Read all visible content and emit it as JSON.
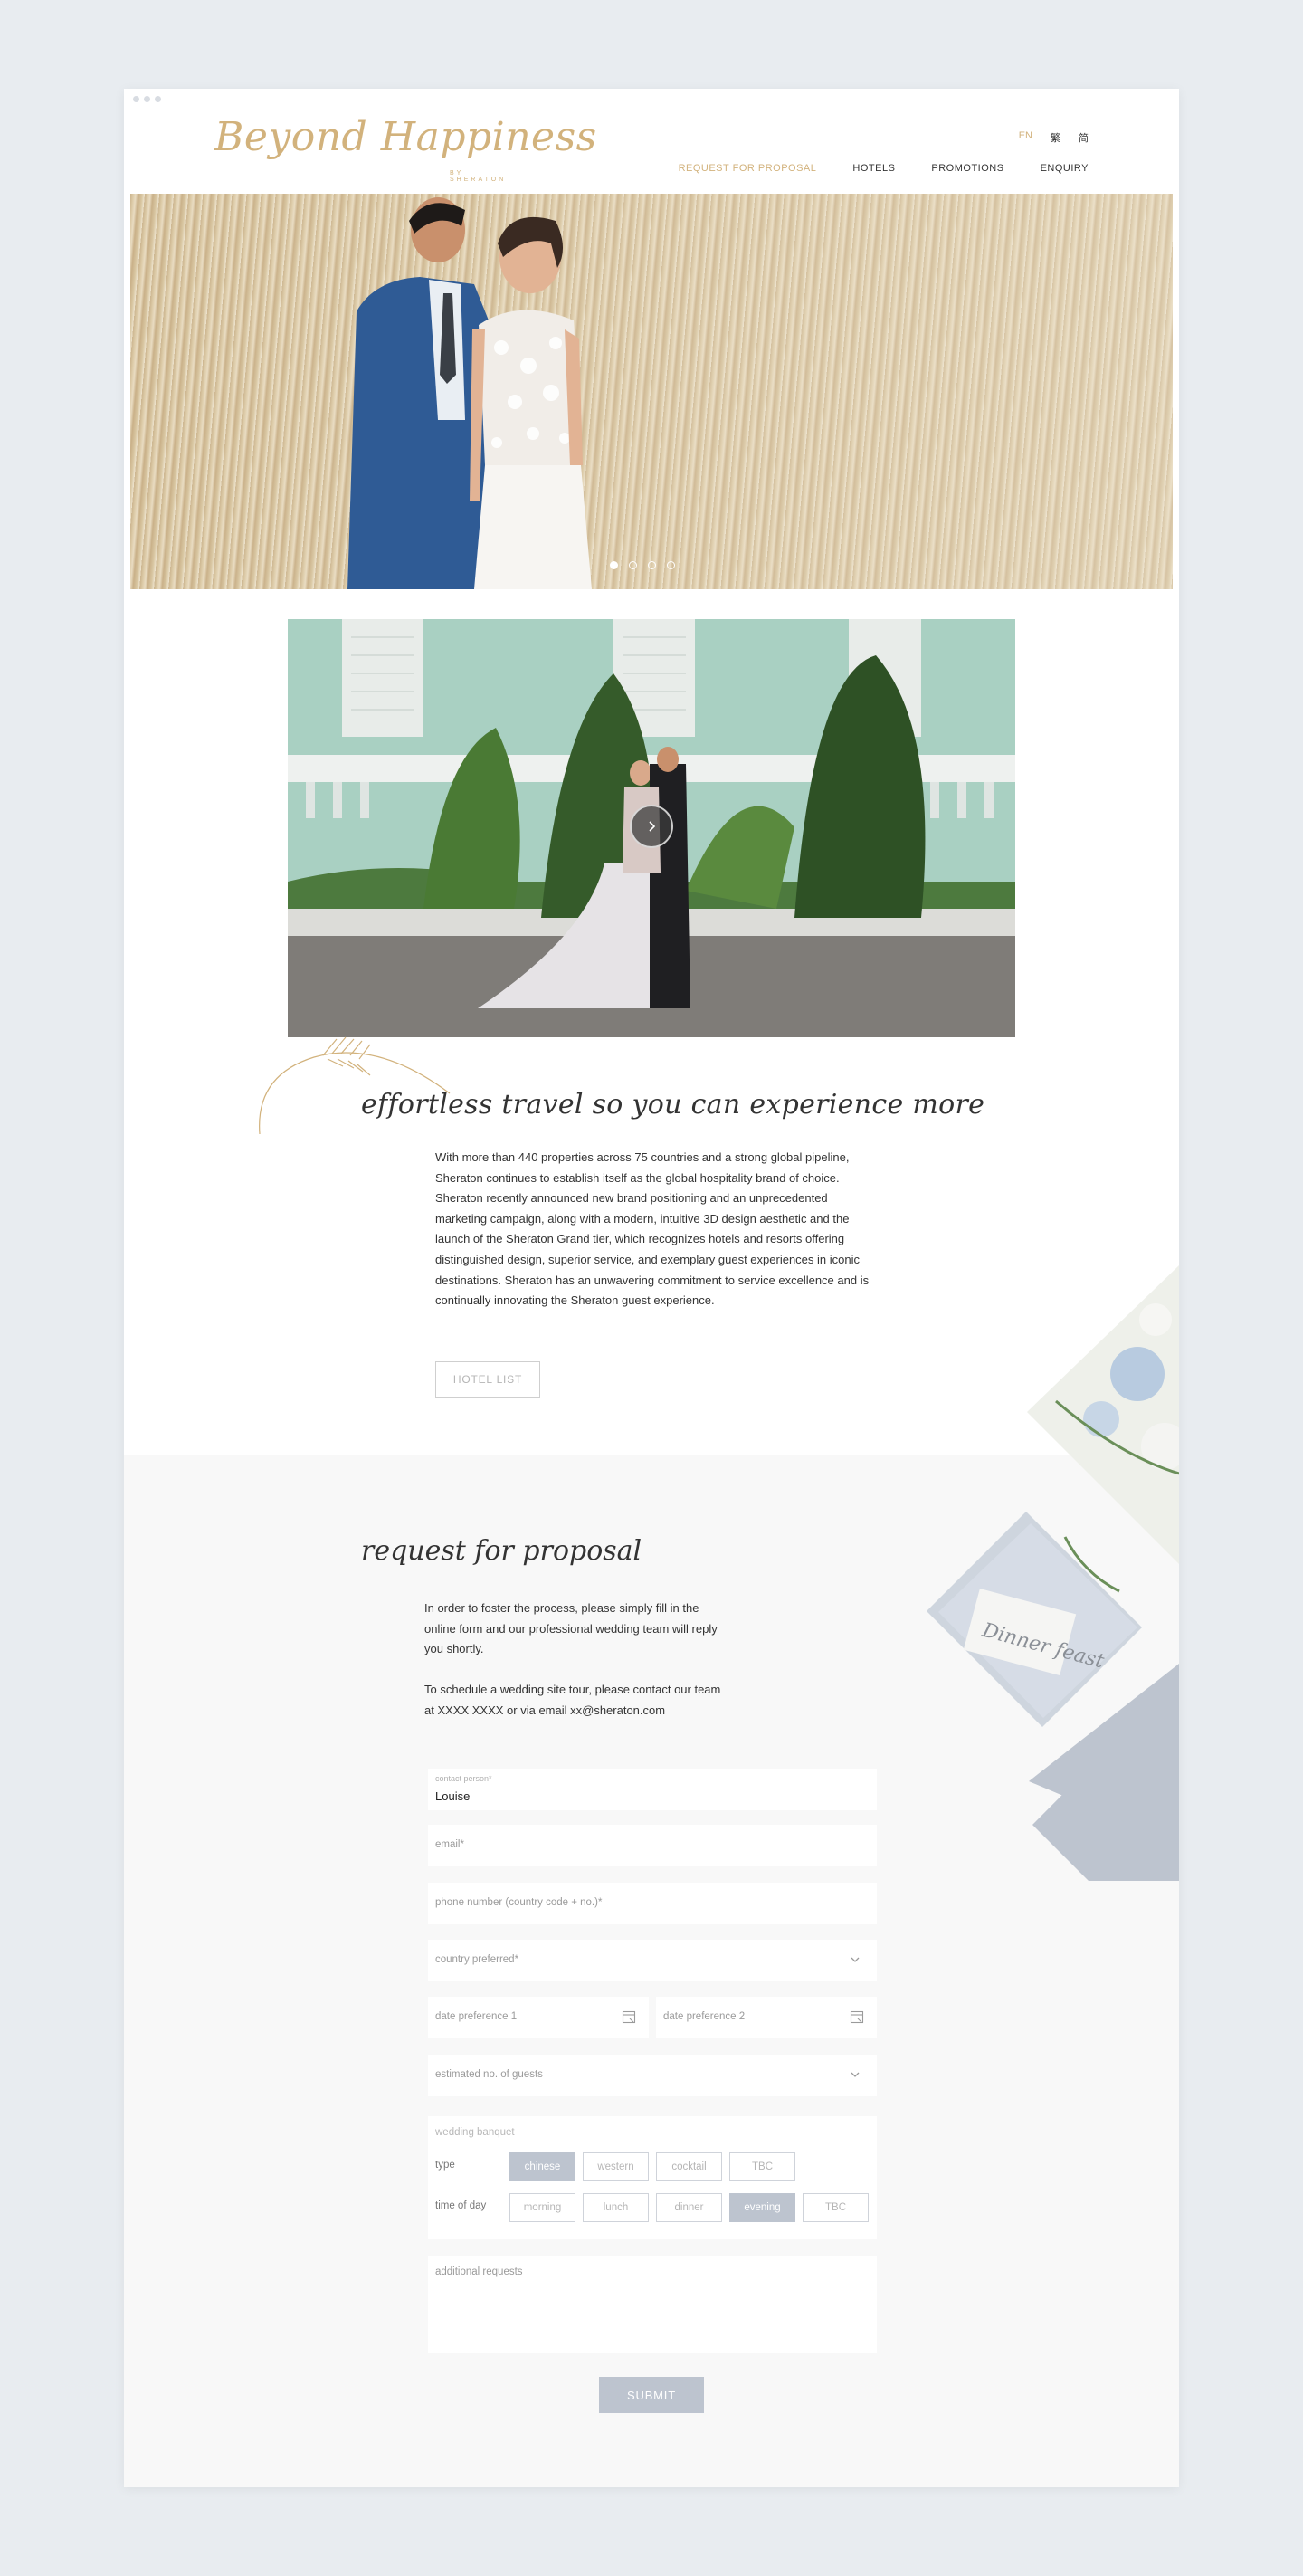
{
  "brand": {
    "logo_script": "Beyond Happiness",
    "logo_sub": "BY SHERATON"
  },
  "languages": [
    "EN",
    "繁",
    "简"
  ],
  "nav": [
    "REQUEST FOR PROPOSAL",
    "HOTELS",
    "PROMOTIONS",
    "ENQUIRY"
  ],
  "hero": {
    "slides": 4,
    "active_slide": 1
  },
  "intro": {
    "tagline": "effortless travel so you can experience more",
    "body": "With more than 440 properties across 75 countries and a strong global pipeline, Sheraton continues to establish itself as the global hospitality brand of choice. Sheraton recently announced new brand positioning and an unprecedented marketing campaign, along with a modern, intuitive 3D design aesthetic and the launch of the Sheraton Grand tier, which recognizes hotels and resorts offering distinguished design, superior service, and exemplary guest experiences in iconic destinations. Sheraton has an unwavering commitment to service excellence and is continually innovating the Sheraton guest experience.",
    "hotel_list_button": "HOTEL LIST"
  },
  "rfp": {
    "title": "request for proposal",
    "paragraph1": "In order to foster the process, please simply fill in the online form and our professional wedding team will reply you shortly.",
    "paragraph2": "To schedule a wedding site tour, please contact our team at XXXX XXXX or via email xx@sheraton.com",
    "contact_label": "contact person*",
    "contact_value": "Louise",
    "email_label": "email*",
    "phone_label": "phone number (country code + no.)*",
    "country_label": "country preferred*",
    "date1_label": "date preference 1",
    "date2_label": "date preference 2",
    "guests_label": "estimated no. of guests",
    "banquet_title": "wedding banquet",
    "type_label": "type",
    "type_options": [
      "chinese",
      "western",
      "cocktail",
      "TBC"
    ],
    "type_selected": "chinese",
    "time_label": "time of day",
    "time_options": [
      "morning",
      "lunch",
      "dinner",
      "evening",
      "TBC"
    ],
    "time_selected": "evening",
    "requests_label": "additional requests",
    "submit": "SUBMIT"
  },
  "decor": {
    "card_script": "Dinner feast"
  },
  "colors": {
    "gold": "#d2b27c",
    "slate": "#bdc4cf",
    "section_bg": "#f8f8f8"
  }
}
